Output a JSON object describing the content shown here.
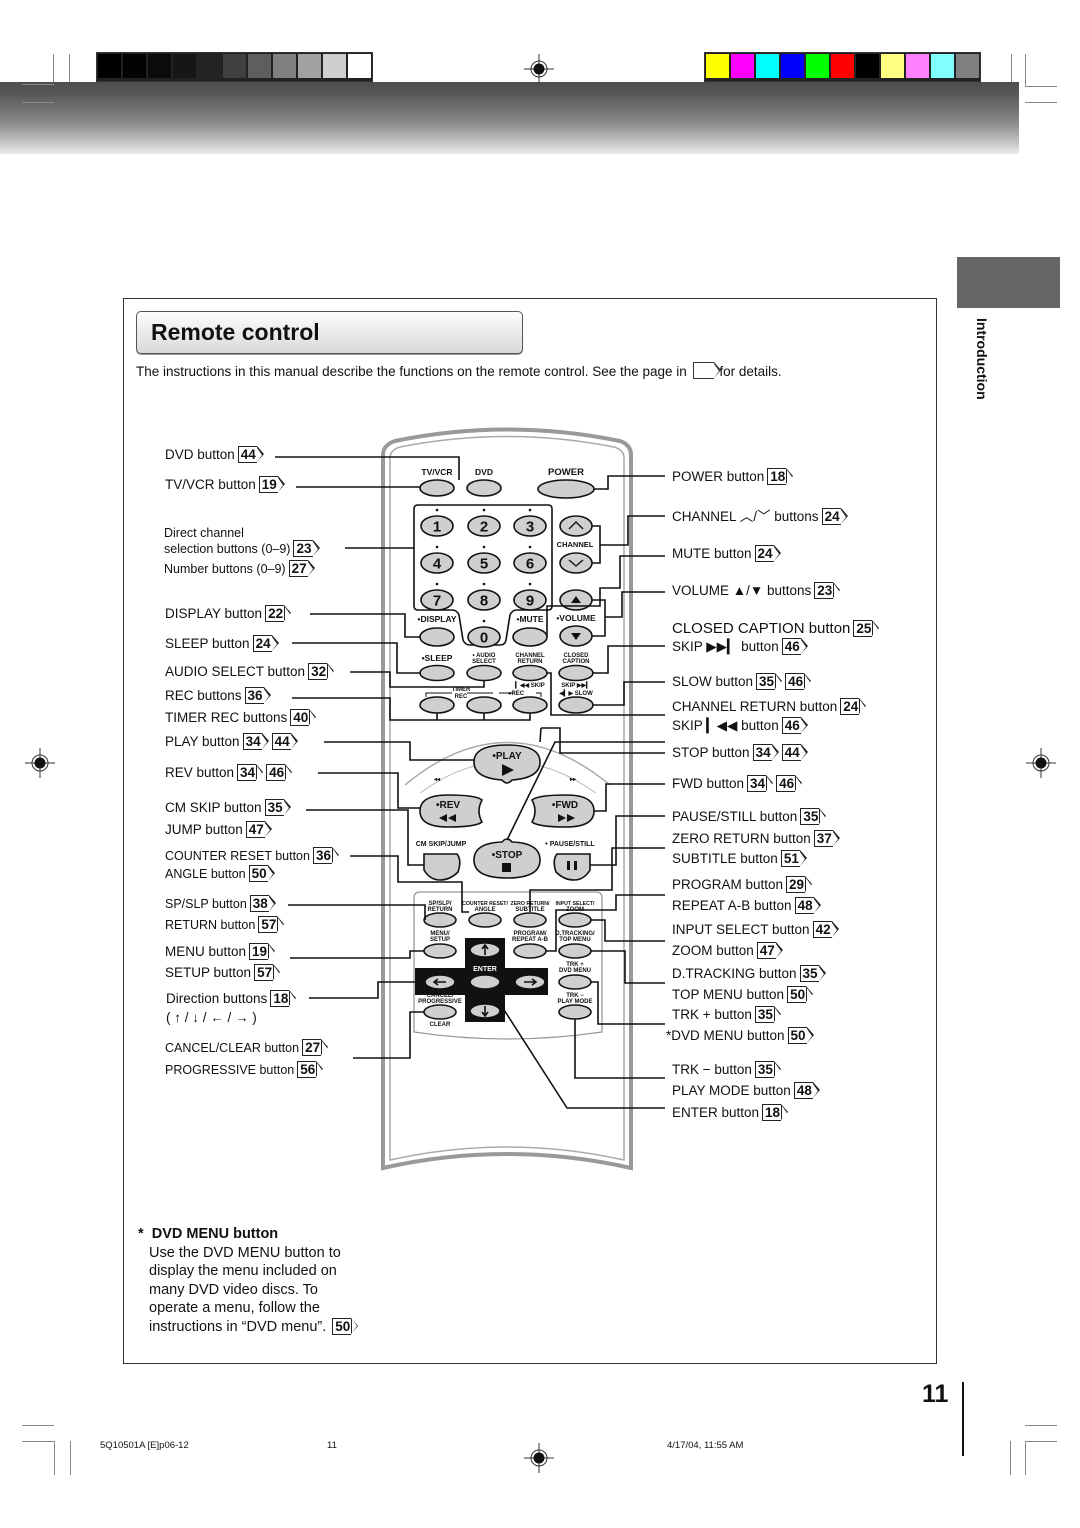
{
  "print_marks": {
    "gray_swatches": [
      "#000000",
      "#030303",
      "#0b0b0b",
      "#161616",
      "#242424",
      "#404040",
      "#5e5e5e",
      "#808080",
      "#a1a1a1",
      "#cfcfcf",
      "#ffffff"
    ],
    "color_swatches": [
      "#ffff00",
      "#ff00ff",
      "#00ffff",
      "#0000ff",
      "#00ff00",
      "#ff0000",
      "#000000",
      "#ffff80",
      "#ff80ff",
      "#80ffff",
      "#808080"
    ]
  },
  "section_tab": {
    "label": "Introduction"
  },
  "title": "Remote control",
  "intro": {
    "before": "The instructions in this manual describe the functions on the remote control. See the page in",
    "after": "for details."
  },
  "left_labels": [
    {
      "text": "DVD button",
      "refs": [
        "44"
      ]
    },
    {
      "text": "TV/VCR button",
      "refs": [
        "19"
      ]
    },
    {
      "text": "Direct channel",
      "refs": []
    },
    {
      "text": "selection buttons (0–9)",
      "refs": [
        "23"
      ]
    },
    {
      "text": "Number buttons (0–9)",
      "refs": [
        "27"
      ]
    },
    {
      "text": "DISPLAY button",
      "refs": [
        "22"
      ]
    },
    {
      "text": "SLEEP button",
      "refs": [
        "24"
      ]
    },
    {
      "text": "AUDIO SELECT button",
      "refs": [
        "32"
      ]
    },
    {
      "text": "REC buttons",
      "refs": [
        "36"
      ]
    },
    {
      "text": "TIMER REC buttons",
      "refs": [
        "40"
      ]
    },
    {
      "text": "PLAY button",
      "refs": [
        "34",
        "44"
      ]
    },
    {
      "text": "REV button",
      "refs": [
        "34",
        "46"
      ]
    },
    {
      "text": "CM SKIP button",
      "refs": [
        "35"
      ]
    },
    {
      "text": "JUMP button",
      "refs": [
        "47"
      ]
    },
    {
      "text": "COUNTER RESET button",
      "refs": [
        "36"
      ]
    },
    {
      "text": "ANGLE button",
      "refs": [
        "50"
      ]
    },
    {
      "text": "SP/SLP button",
      "refs": [
        "38"
      ]
    },
    {
      "text": "RETURN button",
      "refs": [
        "57"
      ]
    },
    {
      "text": "MENU button",
      "refs": [
        "19"
      ]
    },
    {
      "text": "SETUP button",
      "refs": [
        "57"
      ]
    },
    {
      "text": "Direction buttons",
      "refs": [
        "18"
      ]
    },
    {
      "text": "( ↑ / ↓ / ← / → )",
      "refs": []
    },
    {
      "text": "CANCEL/CLEAR button",
      "refs": [
        "27"
      ]
    },
    {
      "text": "PROGRESSIVE button",
      "refs": [
        "56"
      ]
    }
  ],
  "right_labels": [
    {
      "text": "POWER button",
      "refs": [
        "18"
      ]
    },
    {
      "text": "CHANNEL ︿/﹀ buttons",
      "refs": [
        "24"
      ]
    },
    {
      "text": "MUTE button",
      "refs": [
        "24"
      ]
    },
    {
      "text": "VOLUME ▲/▼ buttons",
      "refs": [
        "23"
      ]
    },
    {
      "text": "CLOSED CAPTION button",
      "refs": [
        "25"
      ]
    },
    {
      "text": "SKIP ▶▶▎ button",
      "refs": [
        "46"
      ]
    },
    {
      "text": "SLOW button",
      "refs": [
        "35",
        "46"
      ]
    },
    {
      "text": "CHANNEL RETURN button",
      "refs": [
        "24"
      ]
    },
    {
      "text": "SKIP ▎◀◀ button",
      "refs": [
        "46"
      ]
    },
    {
      "text": "STOP button",
      "refs": [
        "34",
        "44"
      ]
    },
    {
      "text": "FWD button",
      "refs": [
        "34",
        "46"
      ]
    },
    {
      "text": "PAUSE/STILL button",
      "refs": [
        "35"
      ]
    },
    {
      "text": "ZERO RETURN button",
      "refs": [
        "37"
      ]
    },
    {
      "text": "SUBTITLE button",
      "refs": [
        "51"
      ]
    },
    {
      "text": "PROGRAM button",
      "refs": [
        "29"
      ]
    },
    {
      "text": "REPEAT A-B button",
      "refs": [
        "48"
      ]
    },
    {
      "text": "INPUT SELECT button",
      "refs": [
        "42"
      ]
    },
    {
      "text": "ZOOM button",
      "refs": [
        "47"
      ]
    },
    {
      "text": "D.TRACKING button",
      "refs": [
        "35"
      ]
    },
    {
      "text": "TOP MENU button",
      "refs": [
        "50"
      ]
    },
    {
      "text": "TRK + button",
      "refs": [
        "35"
      ]
    },
    {
      "text": "*DVD MENU button",
      "refs": [
        "50"
      ]
    },
    {
      "text": "TRK − button",
      "refs": [
        "35"
      ]
    },
    {
      "text": "PLAY MODE button",
      "refs": [
        "48"
      ]
    },
    {
      "text": "ENTER button",
      "refs": [
        "18"
      ]
    }
  ],
  "remote": {
    "tvvcr": "TV/VCR",
    "dvd": "DVD",
    "power": "POWER",
    "digits": [
      "1",
      "2",
      "3",
      "4",
      "5",
      "6",
      "7",
      "8",
      "9",
      "0"
    ],
    "channel": "CHANNEL",
    "display": "•DISPLAY",
    "mute": "•MUTE",
    "volume": "•VOLUME",
    "sleep": "•SLEEP",
    "audio1": "• AUDIO",
    "audio2": "SELECT",
    "chret1": "CHANNEL",
    "chret2": "RETURN",
    "cc1": "CLOSED",
    "cc2": "CAPTION",
    "skip_back": "▎◀◀ SKIP",
    "skip_fwd": "SKIP ▶▶▎",
    "slow": "◀▎▶ SLOW",
    "timer": "TIMER",
    "rec_small": "REC",
    "rec": "●REC",
    "play": "•PLAY",
    "rev": "•REV",
    "fwd": "•FWD",
    "stop": "•STOP",
    "cmskip": "CM SKIP/JUMP",
    "pause": "• PAUSE/STILL",
    "sp1": "SP/SLP/",
    "sp2": "RETURN",
    "cr1": "COUNTER RESET/",
    "cr2": "ANGLE",
    "zr1": "ZERO RETURN/",
    "zr2": "SUBTITLE",
    "is1": "INPUT SELECT/",
    "is2": "ZOOM",
    "menu1": "MENU/",
    "menu2": "SETUP",
    "prog1": "PROGRAM/",
    "prog2": "REPEAT A-B",
    "dt1": "D.TRACKING/",
    "dt2": "TOP MENU",
    "trkp1": "TRK +",
    "trkp2": "DVD MENU",
    "trkm1": "TRK −",
    "trkm2": "PLAY MODE",
    "enter": "ENTER",
    "cancel1": "CANCEL/",
    "cancel2": "PROGRESSIVE",
    "clear": "CLEAR"
  },
  "note": {
    "star": "*",
    "heading": "DVD MENU button",
    "lines": [
      "Use the DVD MENU button to",
      "display the menu included on",
      "many DVD video discs. To",
      "operate a menu, follow the",
      "instructions in “DVD menu”."
    ],
    "ref": "50"
  },
  "page_number": "11",
  "footer": {
    "job": "5Q10501A [E]p06-12",
    "page": "11",
    "datetime": "4/17/04, 11:55 AM"
  }
}
